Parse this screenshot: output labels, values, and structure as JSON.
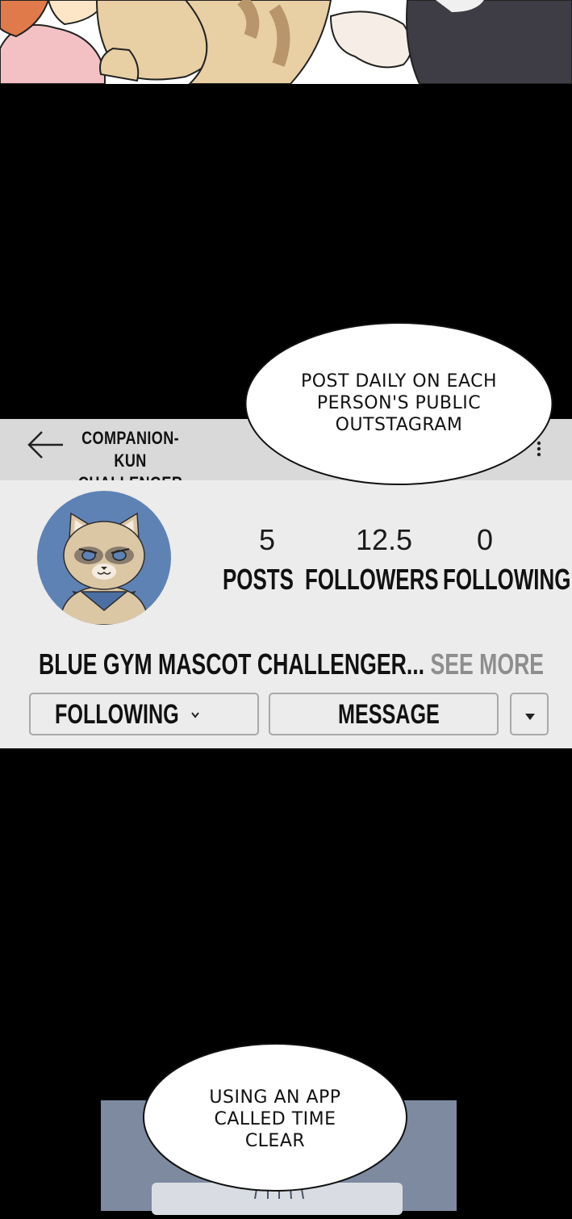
{
  "profile": {
    "account_name": "COMPANION-KUN CHALLENGER",
    "avatar_icon": "raccoon-mascot-avatar",
    "stats": [
      {
        "value": "5",
        "label": "POSTS"
      },
      {
        "value": "12.5",
        "label": "FOLLOWERS"
      },
      {
        "value": "0",
        "label": "FOLLOWING"
      }
    ],
    "bio": "BLUE GYM MASCOT CHALLENGER...",
    "see_more": "SEE MORE",
    "buttons": {
      "following": "FOLLOWING",
      "message": "MESSAGE"
    }
  },
  "bubbles": {
    "top": [
      "POST DAILY ON EACH",
      "PERSON'S PUBLIC",
      "OUTSTAGRAM"
    ],
    "bottom": [
      "USING AN APP",
      "CALLED TIME",
      "CLEAR"
    ]
  },
  "colors": {
    "header_bar": "#d9d9d9",
    "profile_bg": "#ececec",
    "avatar_bg": "#5f82b5",
    "see_more": "#8e8e8e",
    "panel_blue": "#7d8aa0"
  }
}
